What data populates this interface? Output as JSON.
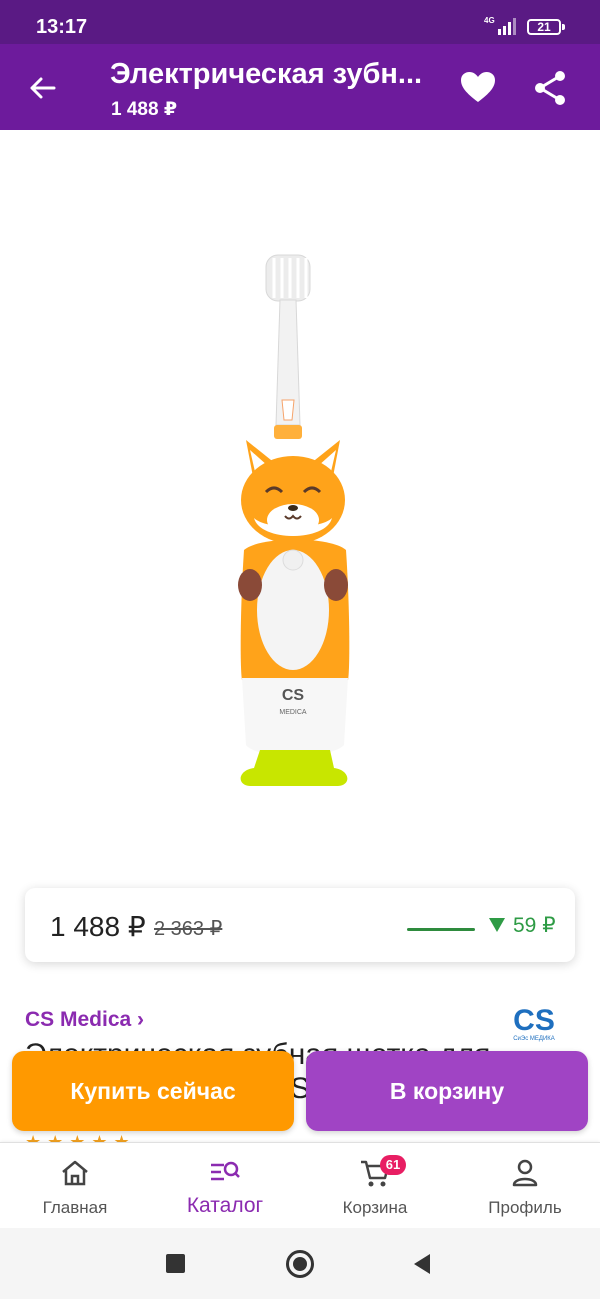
{
  "status_bar": {
    "time": "13:17",
    "network": "4G",
    "battery": "21"
  },
  "header": {
    "title": "Электрическая зубн...",
    "price": "1 488 ₽"
  },
  "product": {
    "image_brand_text": "CS",
    "image_brand_sub": "MEDICA"
  },
  "price_card": {
    "current_price": "1 488 ₽",
    "old_price": "2 363 ₽",
    "price_change": "59 ₽"
  },
  "brand": {
    "link_label": "CS Medica ›",
    "logo_text": "CS",
    "logo_sub": "СиЭс МЕДИКА"
  },
  "title": {
    "text": "Электрическая зубная щетка для детей CS Medica CS-... ...са"
  },
  "actions": {
    "buy_now": "Купить сейчас",
    "add_to_cart": "В корзину"
  },
  "bottom_nav": {
    "items": [
      {
        "label": "Главная",
        "icon": "home-icon"
      },
      {
        "label": "Каталог",
        "icon": "catalog-search-icon",
        "active": true
      },
      {
        "label": "Корзина",
        "icon": "cart-icon",
        "badge": "61"
      },
      {
        "label": "Профиль",
        "icon": "profile-icon"
      }
    ]
  },
  "colors": {
    "status_bar": "#5a1a84",
    "header": "#6d1b9c",
    "accent_purple": "#8b2bb0",
    "buy_now": "#ff9900",
    "add_to_cart": "#a044c4",
    "price_drop": "#2e9b45",
    "badge": "#e81e63"
  }
}
